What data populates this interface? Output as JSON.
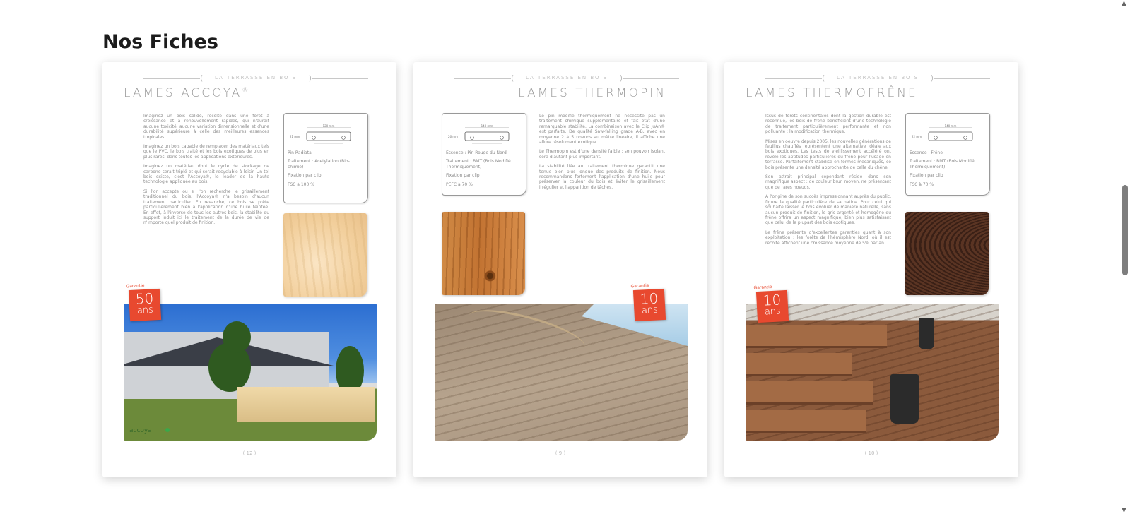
{
  "section": {
    "title": "Nos Fiches"
  },
  "header_label": "LA TERRASSE EN BOIS",
  "cards": [
    {
      "title": "LAMES ACCOYA",
      "title_mark": "®",
      "paragraphs": [
        "Imaginez un bois solide, récolté dans une forêt à croissance et à renouvellement rapides, qui n'aurait aucune toxicité, aucune variation dimensionnelle et d'une durabilité supérieure à celle des meilleures essences tropicales.",
        "Imaginez un bois capable de remplacer des matériaux tels que le PVC, le bois traité et les bois exotiques de plus en plus rares, dans toutes les applications extérieures.",
        "Imaginez un matériau dont le cycle de stockage de carbone serait triplé et qui serait recyclable à loisir. Un tel bois existe, c'est l'Accoya®, le leader de la haute technologie appliquée au bois.",
        "Si l'on accepte ou si l'on recherche le grisaillement traditionnel du bois, l'Accoya® n'a besoin d'aucun traitement particulier. En revanche, ce bois se prête particulièrement bien à l'application d'une huile teintée. En effet, à l'inverse de tous les autres bois, la stabilité du support induit ici le traitement de la durée de vie de n'importe quel produit de finition."
      ],
      "specs": [
        "Pin Radiata",
        "Traitement : Acetylation (Bio-chimie)",
        "Fixation par clip",
        "FSC à 100 %"
      ],
      "badge": {
        "label": "Garantie",
        "number": "50",
        "unit": "ans"
      },
      "page": "12"
    },
    {
      "title": "LAMES THERMOPIN",
      "paragraphs": [
        "Le pin modifié thermiquement ne nécessite pas un traitement chimique supplémentaire et fait état d'une remarquable stabilité. La combinaison avec le Clip JuAn® est parfaite. De qualité Saw-falling grade A-B, avec en moyenne 2 à 5 noeuds au mètre linéaire, il affiche une allure résolument exotique.",
        "Le Thermopin est d'une densité faible : son pouvoir isolant sera d'autant plus important.",
        "La stabilité liée au traitement thermique garantit une tenue bien plus longue des produits de finition. Nous recommandons fortement l'application d'une huile pour préserver la couleur du bois et éviter le grisaillement irrégulier et l'apparition de tâches."
      ],
      "specs": [
        "Essence : Pin Rouge du Nord",
        "Traitement : BMT (Bois Modifié Thermiquement)",
        "Fixation par clip",
        "PEFC à 70 %"
      ],
      "badge": {
        "label": "Garantie",
        "number": "10",
        "unit": "ans"
      },
      "page": "9"
    },
    {
      "title": "LAMES THERMOFRÊNE",
      "paragraphs": [
        "Issus de forêts continentales dont la gestion durable est reconnue, les bois de frêne bénéficient d'une technologie de traitement particulièrement performante et non polluante : la modification thermique.",
        "Mises en oeuvre depuis 2005, les nouvelles générations de feuillus chauffés représentent une alternative idéale aux bois exotiques. Les tests de vieillissement accéléré ont révélé les aptitudes particulières du frêne pour l'usage en terrasse. Parfaitement stabilisé en formes mécaniques, ce bois présente une densité approchante de celle du chêne.",
        "Son attrait principal cependant réside dans son magnifique aspect : de couleur brun moyen, ne présentant que de rares noeuds.",
        "A l'origine de son succès impressionnant auprès du public, figure la qualité particulière de sa patine. Pour celui qui souhaite laisser le bois évoluer de manière naturelle, sans aucun produit de finition, le gris argenté et homogène du frêne offrira un aspect magnifique, bien plus satisfaisant que celui de la plupart des bois exotiques.",
        "Le frêne présente d'excellentes garanties quant à son exploitation : les forêts de l'hémisphère Nord, où il est récolté affichent une croissance moyenne de 5% par an."
      ],
      "specs": [
        "Essence : Frêne",
        "Traitement : BMT (Bois Modifié Thermiquement)",
        "Fixation par clip",
        "FSC à 70 %"
      ],
      "badge": {
        "label": "Garantie",
        "number": "10",
        "unit": "ans"
      },
      "page": "10"
    }
  ],
  "profiles": [
    {
      "width": "120 mm",
      "thickness": "21 mm"
    },
    {
      "width": "140 mm",
      "thickness": "26 mm"
    },
    {
      "width": "140 mm",
      "thickness": "22 mm"
    }
  ],
  "logo": "accoya",
  "scrollbar": {
    "up_icon": "▲",
    "down_icon": "▼"
  }
}
